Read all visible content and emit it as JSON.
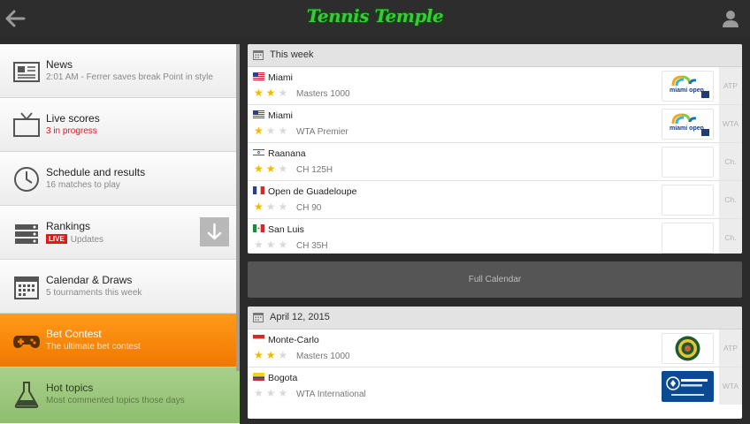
{
  "topbar": {
    "logo_text": "Tennis Temple"
  },
  "sidebar": {
    "items": [
      {
        "title": "News",
        "subtitle": "2:01 AM - Ferrer saves break Point in style"
      },
      {
        "title": "Live scores",
        "subtitle": "3 in progress"
      },
      {
        "title": "Schedule and results",
        "subtitle": "16 matches to play"
      },
      {
        "title": "Rankings",
        "badge": "LIVE",
        "subtitle": "Updates"
      },
      {
        "title": "Calendar & Draws",
        "subtitle": "5 tournaments this week"
      },
      {
        "title": "Bet Contest",
        "subtitle": "The ultimate bet contest"
      },
      {
        "title": "Hot topics",
        "subtitle": "Most commented topics those days"
      }
    ]
  },
  "this_week": {
    "header": "This week",
    "rows": [
      {
        "name": "Miami",
        "category": "Masters 1000",
        "stars": 2,
        "tour": "ATP",
        "flag": "us",
        "logo": "miami open"
      },
      {
        "name": "Miami",
        "category": "WTA Premier",
        "stars": 1,
        "tour": "WTA",
        "flag": "us",
        "logo": "miami open"
      },
      {
        "name": "Raanana",
        "category": "CH 125H",
        "stars": 2,
        "tour": "Ch.",
        "flag": "il",
        "logo": ""
      },
      {
        "name": "Open de Guadeloupe",
        "category": "CH 90",
        "stars": 1,
        "tour": "Ch.",
        "flag": "fr",
        "logo": ""
      },
      {
        "name": "San Luis",
        "category": "CH 35H",
        "stars": 0,
        "tour": "Ch.",
        "flag": "mx",
        "logo": ""
      }
    ]
  },
  "full_calendar": {
    "label": "Full Calendar"
  },
  "april": {
    "header": "April 12, 2015",
    "rows": [
      {
        "name": "Monte-Carlo",
        "category": "Masters 1000",
        "stars": 2,
        "tour": "ATP",
        "flag": "mc",
        "logo": "monte-carlo"
      },
      {
        "name": "Bogota",
        "category": "WTA International",
        "stars": 0,
        "tour": "WTA",
        "flag": "co",
        "logo": "bbva colsanitas"
      }
    ]
  },
  "colors": {
    "accent_orange": "#f57f0a",
    "accent_green": "#9cc77c",
    "star": "#f5b800",
    "live_red": "#e01b1b"
  }
}
